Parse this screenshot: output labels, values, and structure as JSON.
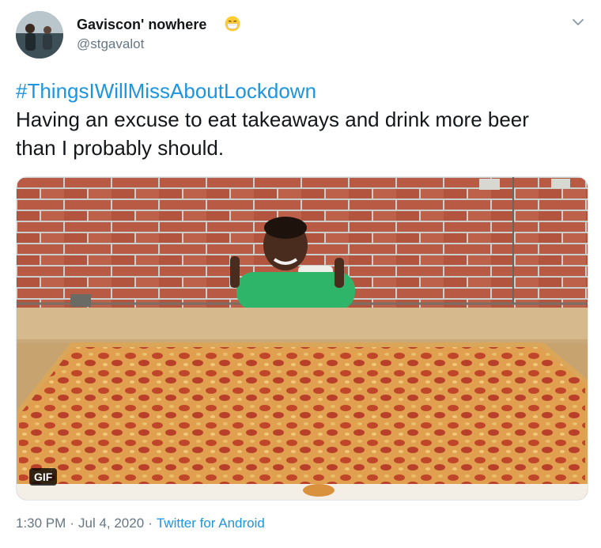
{
  "tweet": {
    "display_name": "Gaviscon' nowhere",
    "handle": "@stgavalot",
    "hashtag": "#ThingsIWillMissAboutLockdown",
    "text": "Having an excuse to eat takeaways and drink more beer than I probably should.",
    "media": {
      "badge": "GIF",
      "icon": "photo-media"
    },
    "time": "1:30 PM",
    "separator": "·",
    "date": "Jul 4, 2020",
    "source": "Twitter for Android",
    "icons": {
      "avatar": "profile-avatar",
      "emoji": "face-with-medical-mask-emoji",
      "menu": "chevron-down-icon"
    },
    "colors": {
      "link": "#1b95e0",
      "secondary_text": "#657786",
      "primary_text": "#14171a"
    }
  }
}
